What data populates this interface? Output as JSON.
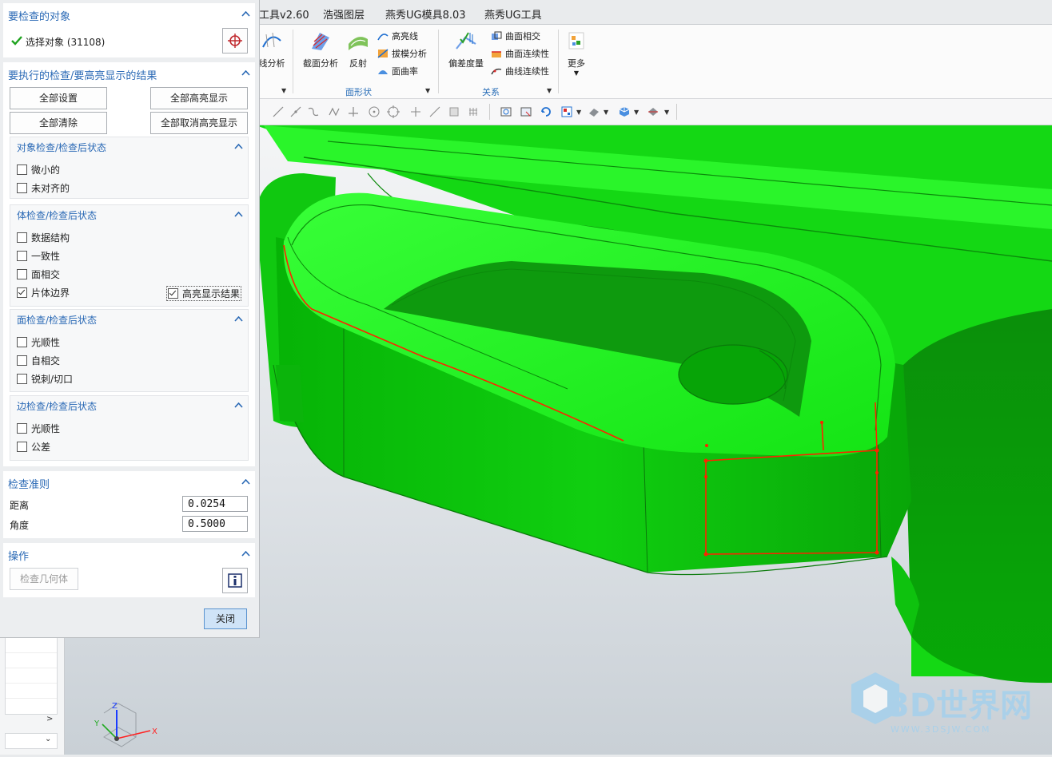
{
  "dialog": {
    "sections": {
      "objects": {
        "title": "要检查的对象",
        "select_label": "选择对象 (31108)"
      },
      "checks": {
        "title": "要执行的检查/要高亮显示的结果",
        "buttons": {
          "set_all": "全部设置",
          "highlight_all": "全部高亮显示",
          "clear_all": "全部清除",
          "unhighlight_all": "全部取消高亮显示"
        },
        "object_group": {
          "title": "对象检查/检查后状态",
          "items": [
            {
              "label": "微小的",
              "checked": false
            },
            {
              "label": "未对齐的",
              "checked": false
            }
          ]
        },
        "body_group": {
          "title": "体检查/检查后状态",
          "items": [
            {
              "label": "数据结构",
              "checked": false
            },
            {
              "label": "一致性",
              "checked": false
            },
            {
              "label": "面相交",
              "checked": false
            },
            {
              "label": "片体边界",
              "checked": true
            }
          ],
          "highlight_label": "高亮显示结果",
          "highlight_checked": true
        },
        "face_group": {
          "title": "面检查/检查后状态",
          "items": [
            {
              "label": "光顺性",
              "checked": false
            },
            {
              "label": "自相交",
              "checked": false
            },
            {
              "label": "锐刺/切口",
              "checked": false
            }
          ]
        },
        "edge_group": {
          "title": "边检查/检查后状态",
          "items": [
            {
              "label": "光顺性",
              "checked": false
            },
            {
              "label": "公差",
              "checked": false
            }
          ]
        }
      },
      "criteria": {
        "title": "检查准则",
        "distance_label": "距离",
        "distance_value": "0.0254",
        "angle_label": "角度",
        "angle_value": "0.5000"
      },
      "operations": {
        "title": "操作",
        "check_geometry": "检查几何体"
      }
    },
    "close_label": "关闭"
  },
  "ribbon": {
    "tabs": [
      "工具v2.60",
      "浩强图层",
      "燕秀UG模具8.03",
      "燕秀UG工具"
    ],
    "buttons": {
      "curve_analysis": "线分析",
      "section_analysis": "截面分析",
      "reflection": "反射",
      "highlight_lines": "高亮线",
      "draft_analysis": "拔模分析",
      "face_curvature": "面曲率",
      "deviation_gauge": "偏差度量",
      "face_intersect": "曲面相交",
      "face_continuity": "曲面连续性",
      "curve_continuity": "曲线连续性",
      "more": "更多"
    },
    "groups": {
      "face_shape": "面形状",
      "relation": "关系"
    }
  },
  "viewport": {
    "watermark_text": "3D世界网",
    "watermark_url": "WWW.3DSJW.COM",
    "axis_x": "X",
    "axis_y": "Y",
    "axis_z": "Z",
    "colors": {
      "model": "#22ee22",
      "edges": "#0a7a0a",
      "highlight": "#ff2200"
    }
  }
}
